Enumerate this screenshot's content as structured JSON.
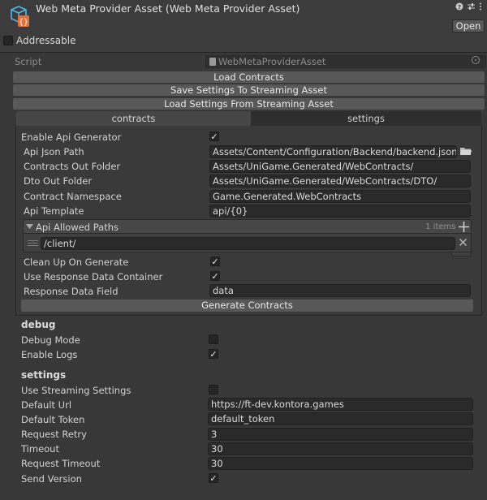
{
  "header": {
    "title": "Web Meta Provider Asset (Web Meta Provider Asset)",
    "open_label": "Open",
    "addressable_label": "Addressable",
    "addressable_checked": false,
    "help_icon": "help-icon",
    "settings_icon": "sliders-icon",
    "menu_icon": "kebab-menu-icon"
  },
  "script": {
    "label": "Script",
    "value": "WebMetaProviderAsset"
  },
  "actions": {
    "load_contracts": "Load Contracts",
    "save_settings": "Save Settings To Streaming Asset",
    "load_settings": "Load Settings From Streaming Asset"
  },
  "tabs": [
    {
      "label": "contracts",
      "selected": false
    },
    {
      "label": "settings",
      "selected": true
    }
  ],
  "contracts": {
    "enable_api_generator": {
      "label": "Enable Api Generator",
      "checked": true
    },
    "api_json_path": {
      "label": "Api Json Path",
      "value": "Assets/Content/Configuration/Backend/backend.json"
    },
    "contracts_out_folder": {
      "label": "Contracts Out Folder",
      "value": "Assets/UniGame.Generated/WebContracts/"
    },
    "dto_out_folder": {
      "label": "Dto Out Folder",
      "value": "Assets/UniGame.Generated/WebContracts/DTO/"
    },
    "contract_namespace": {
      "label": "Contract Namespace",
      "value": "Game.Generated.WebContracts"
    },
    "api_template": {
      "label": "Api Template",
      "value": "api/{0}"
    },
    "allowed_paths": {
      "label": "Api Allowed Paths",
      "count": "1 items",
      "items": [
        "/client/"
      ]
    },
    "clean_up": {
      "label": "Clean Up On Generate",
      "checked": true
    },
    "use_response_container": {
      "label": "Use Response Data Container",
      "checked": true
    },
    "response_field": {
      "label": "Response Data Field",
      "value": "data"
    },
    "generate_label": "Generate Contracts"
  },
  "debug": {
    "heading": "debug",
    "debug_mode": {
      "label": "Debug Mode",
      "checked": false
    },
    "enable_logs": {
      "label": "Enable Logs",
      "checked": true
    }
  },
  "settings": {
    "heading": "settings",
    "use_streaming": {
      "label": "Use Streaming Settings",
      "checked": false
    },
    "default_url": {
      "label": "Default Url",
      "value": "https://ft-dev.kontora.games"
    },
    "default_token": {
      "label": "Default Token",
      "value": "default_token"
    },
    "request_retry": {
      "label": "Request Retry",
      "value": "3"
    },
    "timeout": {
      "label": "Timeout",
      "value": "30"
    },
    "request_timeout": {
      "label": "Request Timeout",
      "value": "30"
    },
    "send_version": {
      "label": "Send Version",
      "checked": true
    }
  }
}
